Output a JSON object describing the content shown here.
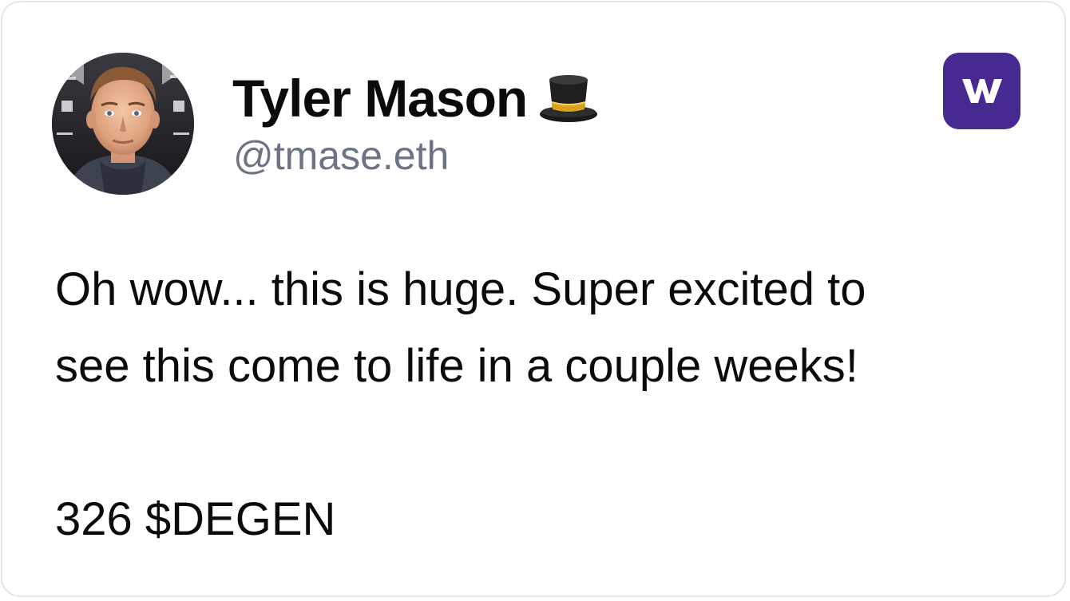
{
  "author": {
    "display_name": "Tyler Mason",
    "name_emoji": "top-hat-icon",
    "handle": "@tmase.eth",
    "avatar": "profile-photo"
  },
  "brand": {
    "icon": "warpcast-logo-icon",
    "letter": "w",
    "color": "#472a91"
  },
  "post": {
    "line1": "Oh wow... this is huge.  Super excited to",
    "line2": "see this come to life in a couple weeks!",
    "line3": "",
    "line4": "326 $DEGEN"
  }
}
